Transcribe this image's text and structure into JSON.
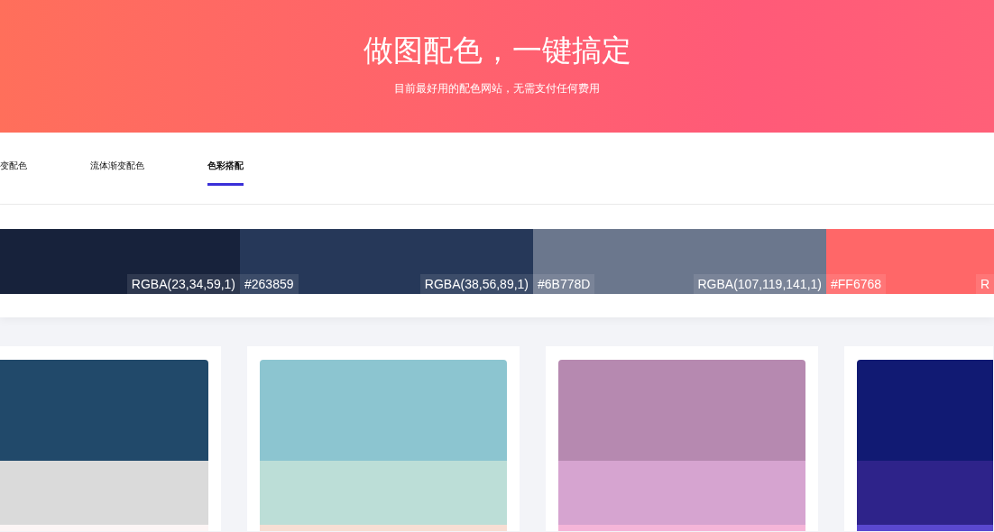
{
  "hero": {
    "title": "做图配色，一键搞定",
    "subtitle": "目前最好用的配色网站，无需支付任何费用"
  },
  "tabs": [
    {
      "label": "变配色",
      "selected": false
    },
    {
      "label": "流体渐变配色",
      "selected": false
    },
    {
      "label": "色彩搭配",
      "selected": true
    }
  ],
  "swatches": [
    {
      "color": "#17223b",
      "rgba": "RGBA(23,34,59,1)"
    },
    {
      "color": "#263859",
      "hex": "#263859",
      "rgba": "RGBA(38,56,89,1)"
    },
    {
      "color": "#6b778d",
      "hex": "#6B778D",
      "rgba": "RGBA(107,119,141,1)"
    },
    {
      "color": "#ff6768",
      "hex": "#FF6768",
      "rgba": "R"
    }
  ],
  "palettes": [
    {
      "bands": [
        {
          "color": "#21496a"
        },
        {
          "color": "#dadada"
        },
        {
          "color": "#fdf5f5"
        }
      ]
    },
    {
      "bands": [
        {
          "color": "#8cc5d0"
        },
        {
          "color": "#bcded7"
        },
        {
          "color": "#f8ddd3"
        }
      ]
    },
    {
      "bands": [
        {
          "color": "#b689b0"
        },
        {
          "color": "#d6a4d0"
        },
        {
          "color": "#f5b5d8"
        }
      ]
    },
    {
      "bands": [
        {
          "color": "#111a73"
        },
        {
          "color": "#2e238a"
        },
        {
          "color": "#5a48d0"
        }
      ]
    }
  ]
}
